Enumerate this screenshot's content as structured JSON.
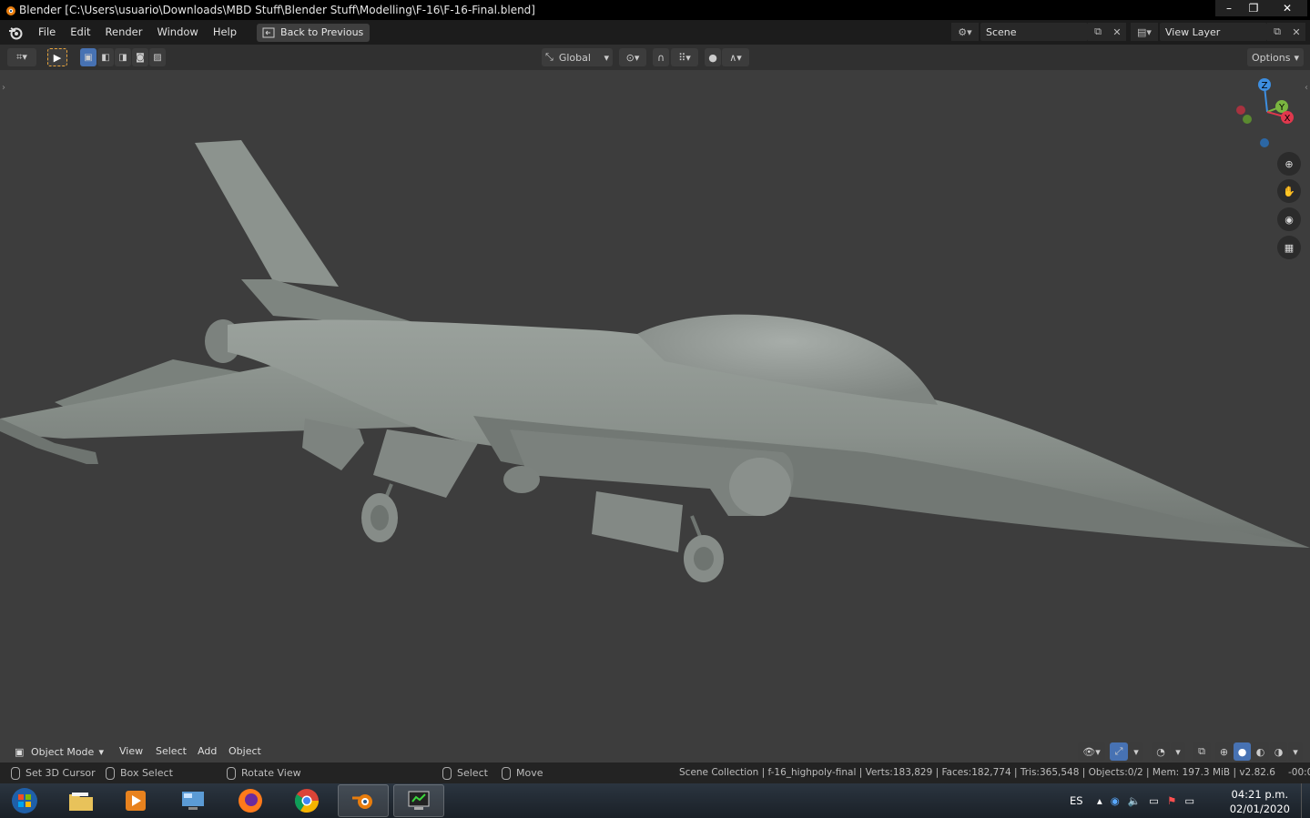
{
  "window": {
    "title": "Blender [C:\\Users\\usuario\\Downloads\\MBD Stuff\\Blender Stuff\\Modelling\\F-16\\F-16-Final.blend]",
    "minimize": "–",
    "maximize": "❐",
    "close": "✕"
  },
  "menubar": {
    "items": [
      "File",
      "Edit",
      "Render",
      "Window",
      "Help"
    ],
    "back_label": "Back to Previous",
    "scene_value": "Scene",
    "view_layer_value": "View Layer"
  },
  "header": {
    "transform_orientation": "Global",
    "options_label": "Options"
  },
  "gizmo": {
    "z_label": "Z",
    "y_label": "Y",
    "x_label": "X"
  },
  "footer": {
    "mode_label": "Object Mode",
    "menu": [
      "View",
      "Select",
      "Add",
      "Object"
    ]
  },
  "statusbar": {
    "left_hint": "Set 3D Cursor",
    "middle_hint": "Box Select",
    "rotate_hint": "Rotate View",
    "select_hint": "Select",
    "move_hint": "Move",
    "stats": "Scene Collection | f-16_highpoly-final | Verts:183,829 | Faces:182,774 | Tris:365,548 | Objects:0/2 | Mem: 197.3 MiB | v2.82.6",
    "edge": "-00:0"
  },
  "taskbar": {
    "language": "ES",
    "time": "04:21 p.m.",
    "date": "02/01/2020"
  },
  "colors": {
    "accent": "#4772b3",
    "axis_x": "#e0384d",
    "axis_y": "#7ab540",
    "axis_z": "#3d8ee0"
  }
}
